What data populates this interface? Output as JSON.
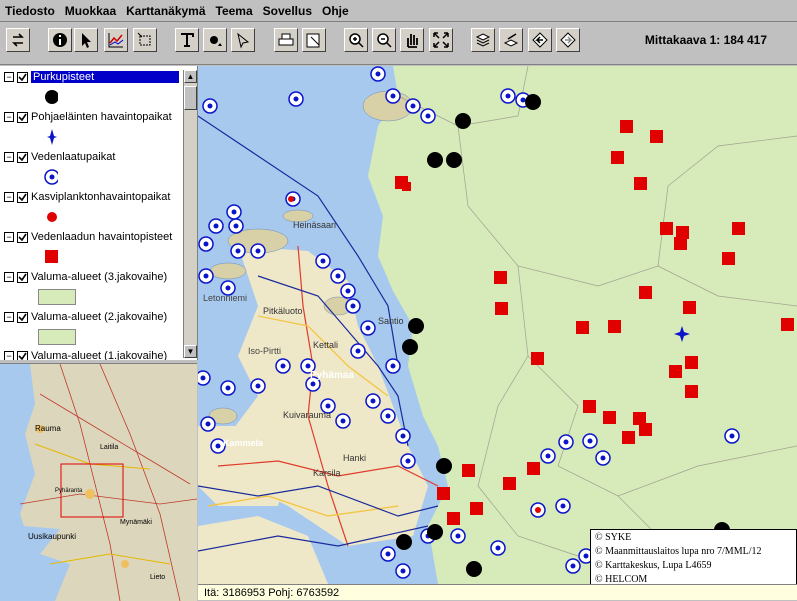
{
  "menubar": {
    "items": [
      "Tiedosto",
      "Muokkaa",
      "Karttanäkymä",
      "Teema",
      "Sovellus",
      "Ohje"
    ]
  },
  "toolbar": {
    "buttons": [
      "refresh-icon",
      "info-icon",
      "pointer-icon",
      "profile-icon",
      "select-box-icon",
      "text-icon",
      "point-tool-icon",
      "polygon-tool-icon",
      "print-icon",
      "export-icon",
      "zoom-in-icon",
      "zoom-out-icon",
      "pan-icon",
      "full-extent-icon",
      "layers-icon",
      "back-icon",
      "prev-extent-icon",
      "next-extent-icon"
    ],
    "scale_label": "Mittakaava 1: 184 417"
  },
  "legend": {
    "layers": [
      {
        "label": "Purkupisteet",
        "selected": true,
        "symbol": "black-dot"
      },
      {
        "label": "Pohjaeläinten havaintopaikat",
        "selected": false,
        "symbol": "blue-star"
      },
      {
        "label": "Vedenlaatupaikat",
        "selected": false,
        "symbol": "blue-ring"
      },
      {
        "label": "Kasviplanktonhavaintopaikat",
        "selected": false,
        "symbol": "red-dot"
      },
      {
        "label": "Vedenlaadun havaintopisteet",
        "selected": false,
        "symbol": "red-square"
      },
      {
        "label": "Valuma-alueet (3.jakovaihe)",
        "selected": false,
        "symbol": "green-rect"
      },
      {
        "label": "Valuma-alueet (2.jakovaihe)",
        "selected": false,
        "symbol": "green-rect"
      },
      {
        "label": "Valuma-alueet (1.jakovaihe)",
        "selected": false,
        "symbol": "green-rect"
      }
    ]
  },
  "map": {
    "labels": [
      "Pitkäluoto",
      "Kettali",
      "Pyhämaa",
      "Santio",
      "Kuivarauma",
      "Kammela",
      "Karsila",
      "Letonniemi",
      "Iso-Pirtti",
      "Hanki",
      "Heinäsaari"
    ],
    "copyright": [
      "© SYKE",
      "© Maanmittauslaitos lupa nro 7/MML/12",
      "© Karttakeskus, Lupa L4659",
      "© HELCOM"
    ]
  },
  "overview": {
    "labels": [
      "Rauma",
      "Pyhäranta",
      "Uusikaupunki",
      "Laitila",
      "Mynämäki",
      "Lieto"
    ]
  },
  "status": {
    "coords": "Itä: 3186953 Pohj: 6763592"
  },
  "colors": {
    "land": "#d7eab9",
    "sea": "#a8c9ee",
    "point_red": "#e00000",
    "point_blue": "#0a14c8"
  }
}
